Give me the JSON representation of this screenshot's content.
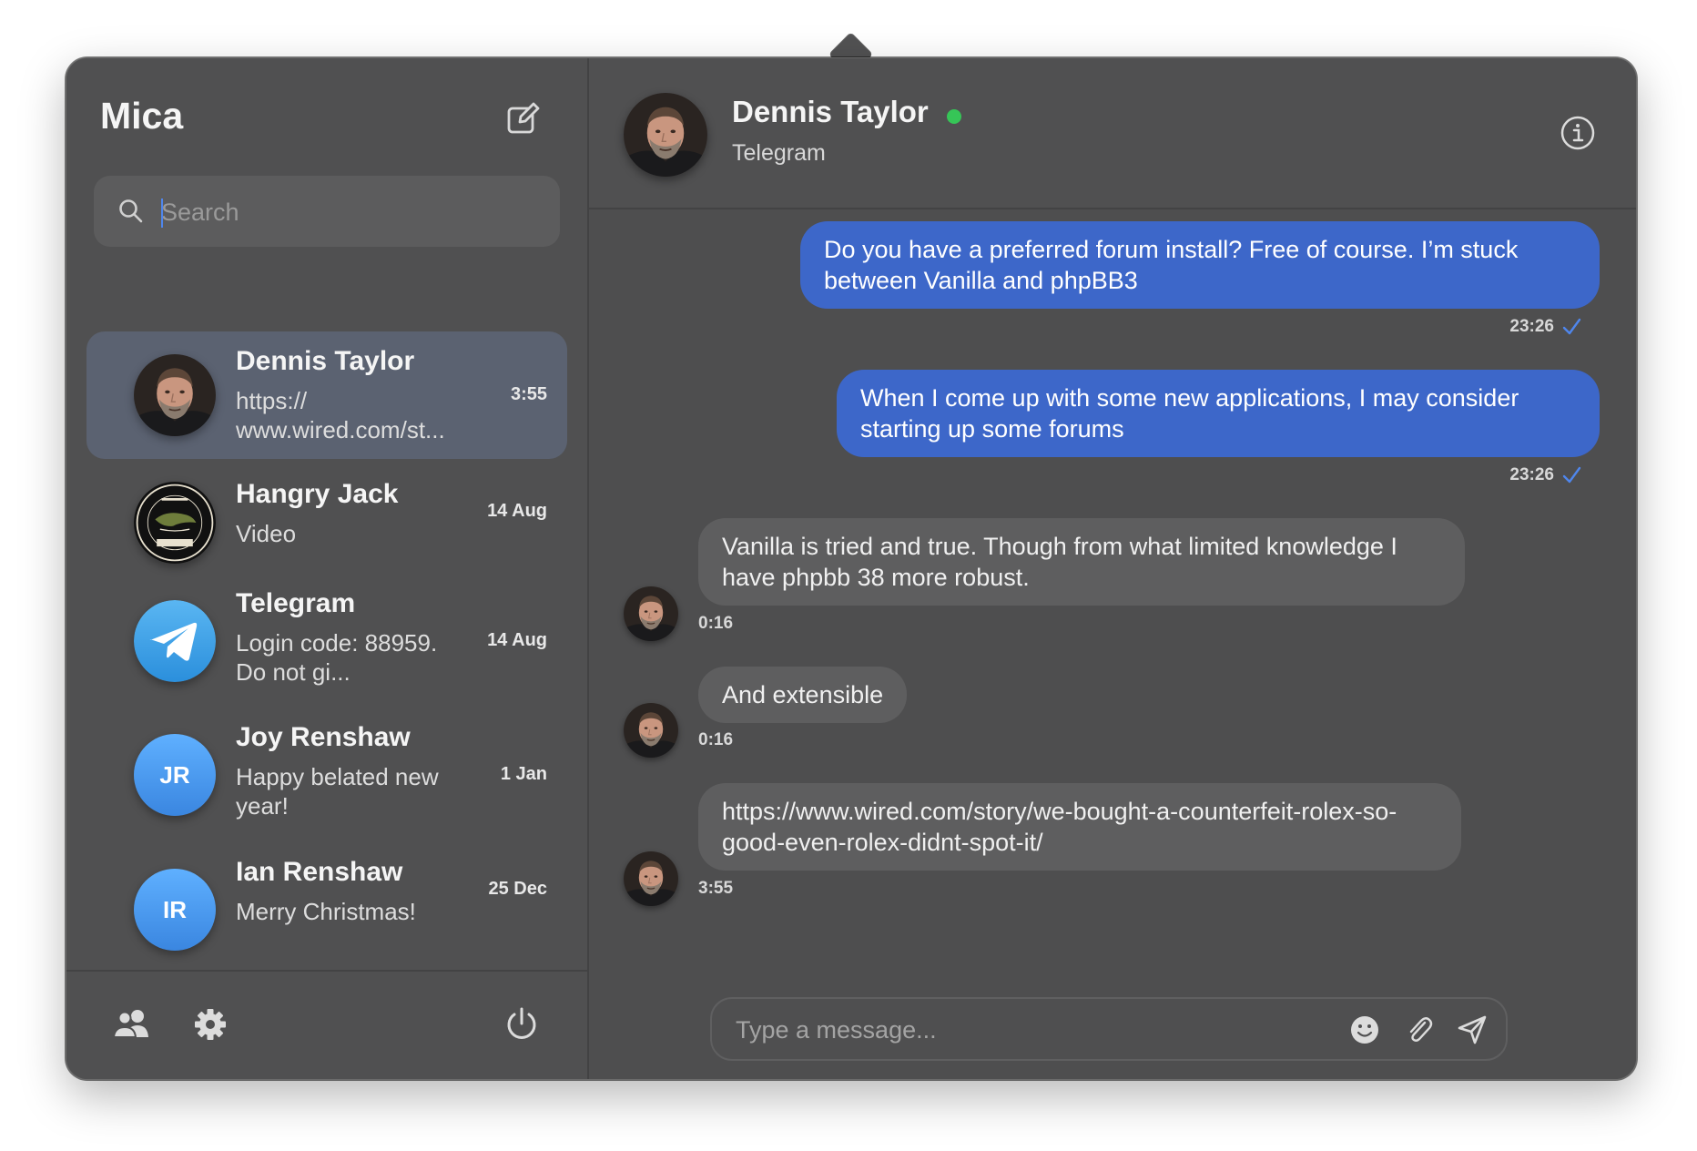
{
  "app": {
    "title": "Mica"
  },
  "search": {
    "placeholder": "Search"
  },
  "conversations": [
    {
      "name": "Dennis Taylor",
      "preview": "https:// www.wired.com/st...",
      "time": "3:55",
      "avatar": "photo-avatar",
      "active": true
    },
    {
      "name": "Hangry Jack",
      "preview": "Video",
      "time": "14 Aug",
      "avatar": "logo-avatar"
    },
    {
      "name": "Telegram",
      "preview": "Login code: 88959. Do not gi...",
      "time": "14 Aug",
      "avatar": "telegram-icon"
    },
    {
      "name": "Joy Renshaw",
      "preview": "Happy belated new year!",
      "time": "1 Jan",
      "initials": "JR"
    },
    {
      "name": "Ian Renshaw",
      "preview": "Merry Christmas!",
      "time": "25 Dec",
      "initials": "IR"
    }
  ],
  "chat": {
    "contact_name": "Dennis Taylor",
    "contact_service": "Telegram",
    "status_color": "#36c557",
    "messages": [
      {
        "direction": "out",
        "text": "Do you have a preferred forum install? Free of course. I’m stuck between Vanilla and phpBB3",
        "time": "23:26",
        "read": true
      },
      {
        "direction": "out",
        "text": "When I come up with some new applications, I may consider starting up some forums",
        "time": "23:26",
        "read": true
      },
      {
        "direction": "in",
        "text": "Vanilla is tried and true. Though from what limited knowledge I have phpbb 38 more robust.",
        "time": "0:16"
      },
      {
        "direction": "in",
        "text": "And extensible",
        "time": "0:16"
      },
      {
        "direction": "in",
        "text": "https://www.wired.com/story/we-bought-a-counterfeit-rolex-so-good-even-rolex-didnt-spot-it/",
        "time": "3:55"
      }
    ]
  },
  "composer": {
    "placeholder": "Type a message..."
  },
  "colors": {
    "accent": "#3d67c9",
    "check": "#4f86ec",
    "online": "#36c557"
  },
  "icons": [
    "compose-icon",
    "search-icon",
    "info-icon",
    "contacts-icon",
    "gear-icon",
    "power-icon",
    "emoji-icon",
    "paperclip-icon",
    "send-icon",
    "checkmark-icon"
  ]
}
